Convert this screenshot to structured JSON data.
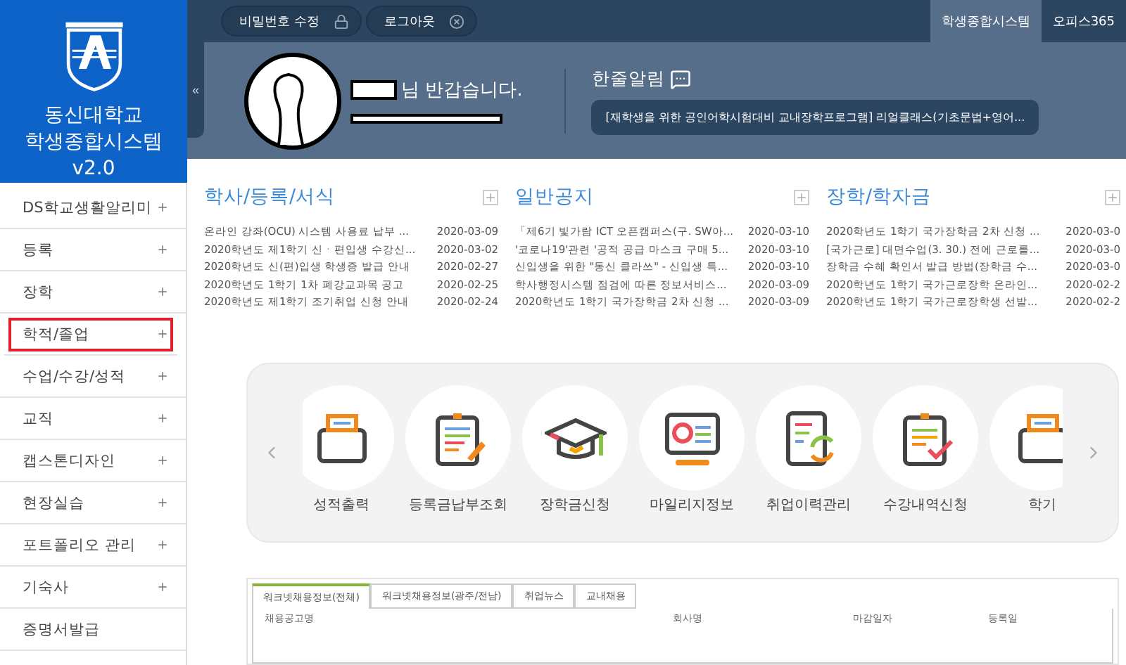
{
  "top_bar": {
    "buttons": [
      {
        "label": "비밀번호 수정",
        "kind": "lock"
      },
      {
        "label": "로그아웃",
        "kind": "close"
      }
    ],
    "tabs": [
      {
        "label": "학생종합시스템",
        "selected": true
      },
      {
        "label": "오피스365",
        "selected": false
      }
    ]
  },
  "brand": {
    "lines": [
      "동신대학교",
      "학생종합시스템"
    ],
    "version": "v2.0"
  },
  "collapse": "«",
  "profile": {
    "greeting": "님 반갑습니다."
  },
  "notice": {
    "title": "한줄알림",
    "text": "[재학생을 위한 공인어학시험대비 교내장학프로그램] 리얼클래스(기초문법+영어..."
  },
  "sidebar": {
    "items": [
      {
        "label": "DS학교생활알리미",
        "expandable": true,
        "selected": false
      },
      {
        "label": "등록",
        "expandable": true,
        "selected": false
      },
      {
        "label": "장학",
        "expandable": true,
        "selected": false
      },
      {
        "label": "학적/졸업",
        "expandable": true,
        "selected": true
      },
      {
        "label": "수업/수강/성적",
        "expandable": true,
        "selected": false
      },
      {
        "label": "교직",
        "expandable": true,
        "selected": false
      },
      {
        "label": "캡스톤디자인",
        "expandable": true,
        "selected": false
      },
      {
        "label": "현장실습",
        "expandable": true,
        "selected": false
      },
      {
        "label": "포트폴리오 관리",
        "expandable": true,
        "selected": false
      },
      {
        "label": "기숙사",
        "expandable": true,
        "selected": false
      },
      {
        "label": "증명서발급",
        "expandable": false,
        "selected": false
      }
    ]
  },
  "boards": [
    {
      "title": "학사/등록/서식",
      "posts": [
        {
          "title": "온라인 강좌(OCU) 시스템 사용료 납부 ...",
          "date": "2020-03-09"
        },
        {
          "title": "2020학년도 제1학기 신ㆍ편입생 수강신...",
          "date": "2020-03-02"
        },
        {
          "title": "2020학년도 신(편)입생 학생증 발급 안내",
          "date": "2020-02-27"
        },
        {
          "title": "2020학년도 1학기 1차 폐강교과목 공고",
          "date": "2020-02-25"
        },
        {
          "title": "2020학년도 제1학기 조기취업 신청 안내",
          "date": "2020-02-24"
        }
      ]
    },
    {
      "title": "일반공지",
      "posts": [
        {
          "title": "「제6기 빛가람 ICT 오픈캠퍼스(구. SW아...",
          "date": "2020-03-10"
        },
        {
          "title": "'코로나19'관련 '공적 공급 마스크 구매 5...",
          "date": "2020-03-10"
        },
        {
          "title": "신입생을 위한 \"동신 클라쓰\" - 신입생 특...",
          "date": "2020-03-10"
        },
        {
          "title": "학사행정시스템 점검에 따른 정보서비스...",
          "date": "2020-03-09"
        },
        {
          "title": "2020학년도 1학기 국가장학금 2차 신청 ...",
          "date": "2020-03-09"
        }
      ]
    },
    {
      "title": "장학/학자금",
      "posts": [
        {
          "title": "2020학년도 1학기 국가장학금 2차 신청 ...",
          "date": "2020-03-0"
        },
        {
          "title": "[국가근로] 대면수업(3. 30.) 전에 근로를...",
          "date": "2020-03-0"
        },
        {
          "title": "장학금 수혜 확인서 발급 방법(장학금 수...",
          "date": "2020-03-0"
        },
        {
          "title": "2020학년도 1학기 국가근로장학 온라인...",
          "date": "2020-02-2"
        },
        {
          "title": "2020학년도 1학기 국가근로장학생 선발...",
          "date": "2020-02-2"
        }
      ]
    }
  ],
  "quick_links": [
    {
      "label": "성적출력",
      "kind": "briefcase"
    },
    {
      "label": "등록금납부조회",
      "kind": "clipboard-pen"
    },
    {
      "label": "장학금신청",
      "kind": "cap"
    },
    {
      "label": "마일리지정보",
      "kind": "monitor"
    },
    {
      "label": "취업이력관리",
      "kind": "refresh"
    },
    {
      "label": "수강내역신청",
      "kind": "clipboard-check"
    },
    {
      "label": "학기",
      "kind": "briefcase"
    }
  ],
  "jobs": {
    "tabs": [
      {
        "label": "워크넷채용정보(전체)",
        "selected": true
      },
      {
        "label": "워크넷채용정보(광주/전남)",
        "selected": false
      },
      {
        "label": "취업뉴스",
        "selected": false
      },
      {
        "label": "교내채용",
        "selected": false
      }
    ],
    "columns": [
      "채용공고명",
      "회사명",
      "마감일자",
      "등록일"
    ]
  }
}
